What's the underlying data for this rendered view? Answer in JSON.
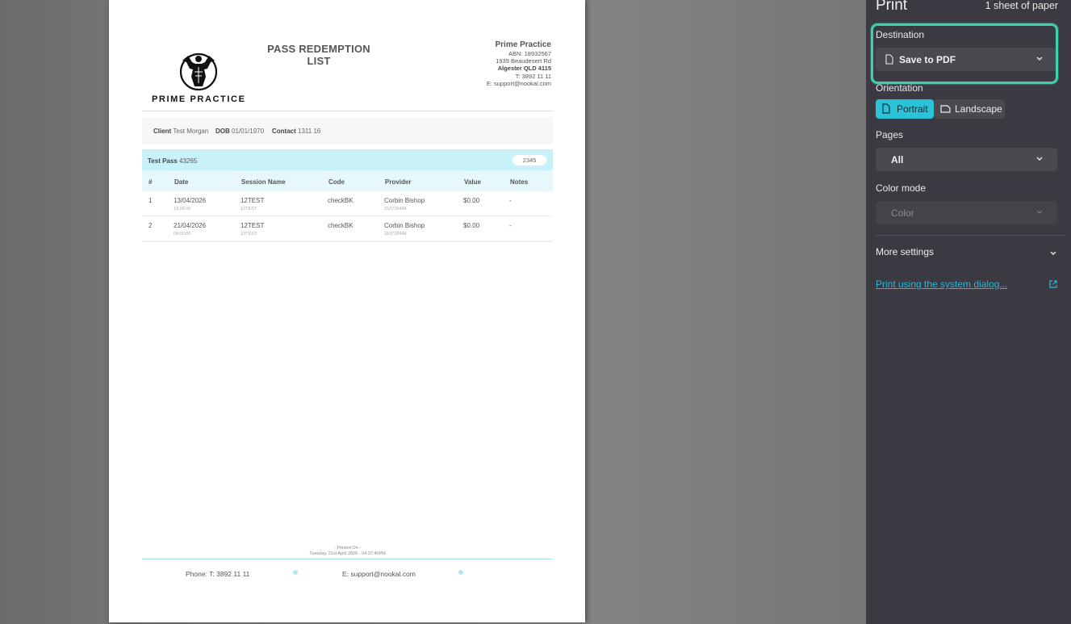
{
  "document": {
    "title": "PASS REDEMPTION LIST",
    "logo_text": "PRIME PRACTICE",
    "company": {
      "name": "Prime Practice",
      "abn": "ABN: 18932567",
      "address": "1939 Beaudesert Rd",
      "suburb": "Algester QLD 4115",
      "phone": "T: 3892 11 11",
      "email": "E: support@nookal.com"
    },
    "client": {
      "client_label": "Client",
      "client_value": "Test Morgan",
      "dob_label": "DOB",
      "dob_value": "01/01/1970",
      "contact_label": "Contact",
      "contact_value": "1311 16"
    },
    "pass": {
      "name_label": "Test Pass",
      "name_value": "43265",
      "badge": "2345"
    },
    "table": {
      "headers": [
        "#",
        "Date",
        "Session Name",
        "Code",
        "Provider",
        "Value",
        "Notes"
      ],
      "rows": [
        {
          "num": "1",
          "date": "13/04/2026",
          "time": "13:00:00",
          "session": "12TEST",
          "session_sub": "12TEST",
          "code": "checkBK",
          "provider": "Corbin Bishop",
          "provider_sub": "15372944K",
          "value": "$0.00",
          "notes": "-"
        },
        {
          "num": "2",
          "date": "21/04/2026",
          "time": "08:00:00",
          "session": "12TEST",
          "session_sub": "12TEST",
          "code": "checkBK",
          "provider": "Corbin Bishop",
          "provider_sub": "15372944K",
          "value": "$0.00",
          "notes": "-"
        }
      ]
    },
    "printed_on_label": "- Printed On -",
    "printed_on_value": "Tuesday, 21st April 2026 - 04:37:40PM",
    "footer": {
      "phone": "Phone: T: 3892 11 11",
      "email": "E: support@nookal.com"
    }
  },
  "print_panel": {
    "title": "Print",
    "sheet_count": "1 sheet of paper",
    "destination_label": "Destination",
    "destination_value": "Save to PDF",
    "orientation_label": "Orientation",
    "orientation_portrait": "Portrait",
    "orientation_landscape": "Landscape",
    "pages_label": "Pages",
    "pages_value": "All",
    "color_label": "Color mode",
    "color_value": "Color",
    "more_settings": "More settings",
    "system_dialog_link": "Print using the system dialog...",
    "accent_color": "#29c3da",
    "highlight_color": "#3dd1b0"
  }
}
